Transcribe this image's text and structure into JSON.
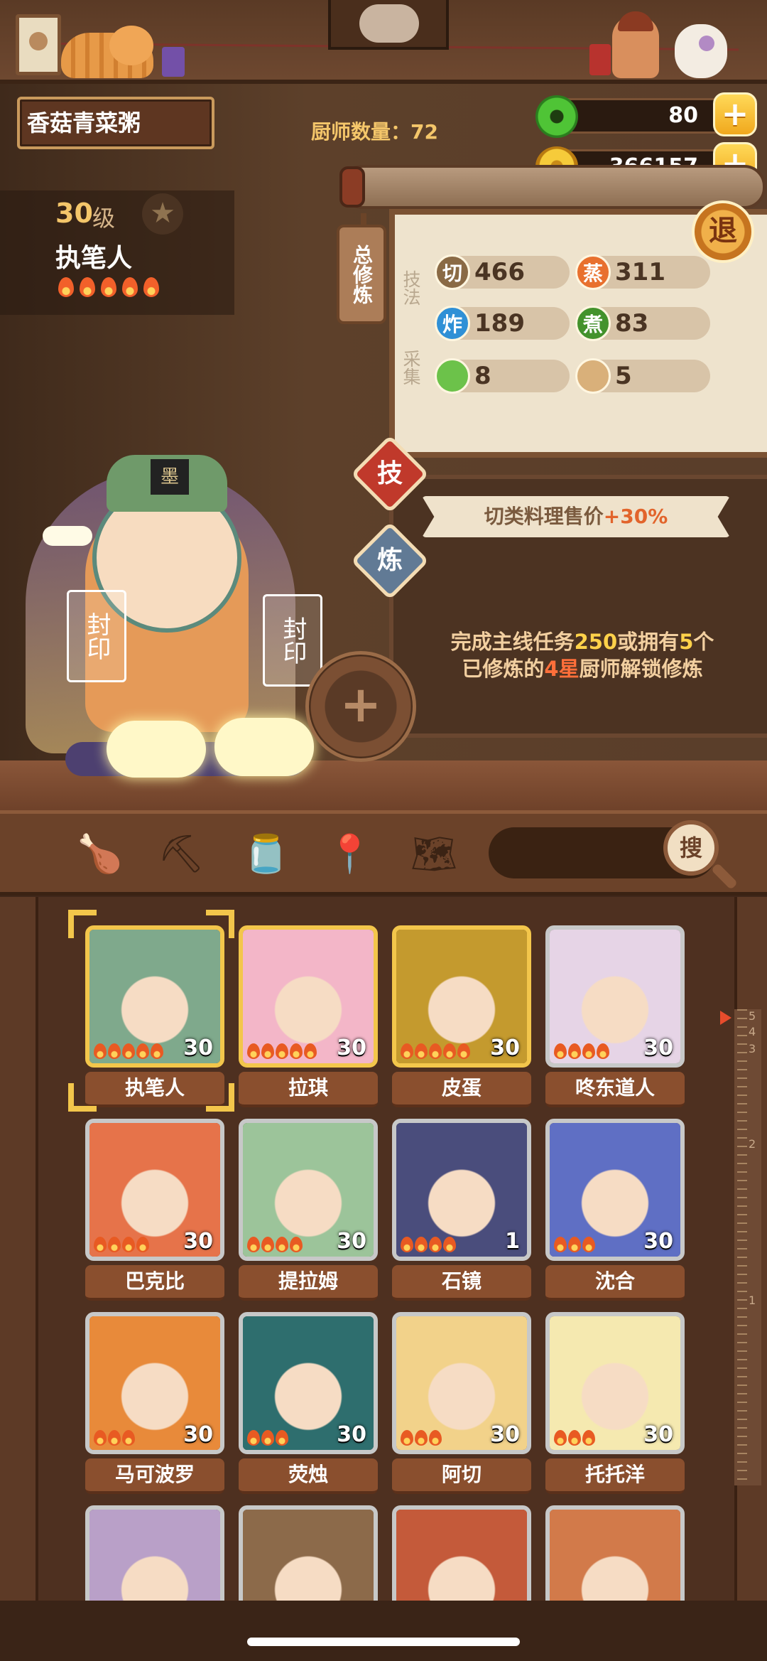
{
  "header": {
    "dish_name": "香菇青菜粥",
    "chef_count_label": "厨师数量：72"
  },
  "resources": {
    "jade": "80",
    "coins": "366157",
    "plus_symbol": "+"
  },
  "chef": {
    "level": "30",
    "level_unit": "级",
    "star_symbol": "★",
    "name": "执笔人",
    "flame_count": 5
  },
  "stats": {
    "total_tag": "总修炼",
    "skill_label": "技法",
    "gather_label": "采集",
    "skills": [
      {
        "icon": "切",
        "value": "466"
      },
      {
        "icon": "蒸",
        "value": "311"
      },
      {
        "icon": "炸",
        "value": "189"
      },
      {
        "icon": "煮",
        "value": "83"
      }
    ],
    "gather": [
      {
        "icon": "vegetable-icon",
        "value": "8"
      },
      {
        "icon": "grain-icon",
        "value": "5"
      }
    ],
    "retreat_label": "退"
  },
  "tabs": {
    "skill": "技",
    "refine": "炼"
  },
  "buff": {
    "text": "切类料理售价",
    "bonus": "+30%"
  },
  "unlock": {
    "part1": "完成主线任务",
    "quest": "250",
    "part2": "或拥有",
    "count": "5",
    "part3": "个",
    "part4": "已修炼的",
    "star": "4星",
    "part5": "厨师解锁修炼"
  },
  "showcase": {
    "hat_badge": "墨",
    "banner_left": "封印",
    "banner_right": "封印",
    "add_symbol": "+"
  },
  "toolbar": {
    "icons": [
      "drumstick-icon",
      "shovel-icon",
      "jar-icon",
      "location-pin-icon",
      "map-question-icon"
    ],
    "search_label": "搜"
  },
  "ruler": {
    "numbers": [
      "5",
      "4",
      "3",
      "2",
      "1"
    ]
  },
  "chefs": [
    {
      "name": "执笔人",
      "level": "30",
      "flames": 5,
      "rarity": "gold",
      "color": "#7fa98c"
    },
    {
      "name": "拉琪",
      "level": "30",
      "flames": 5,
      "rarity": "gold",
      "color": "#f3b6c8"
    },
    {
      "name": "皮蛋",
      "level": "30",
      "flames": 5,
      "rarity": "gold",
      "color": "#c49a2e"
    },
    {
      "name": "咚东道人",
      "level": "30",
      "flames": 4,
      "rarity": "silver",
      "color": "#e6d4e6"
    },
    {
      "name": "巴克比",
      "level": "30",
      "flames": 4,
      "rarity": "silver",
      "color": "#e6734a"
    },
    {
      "name": "提拉姆",
      "level": "30",
      "flames": 4,
      "rarity": "silver",
      "color": "#9cc49a"
    },
    {
      "name": "石镜",
      "level": "1",
      "flames": 4,
      "rarity": "silver",
      "color": "#4a4d7c"
    },
    {
      "name": "沈合",
      "level": "30",
      "flames": 3,
      "rarity": "silver",
      "color": "#5f6fc4"
    },
    {
      "name": "马可波罗",
      "level": "30",
      "flames": 3,
      "rarity": "silver",
      "color": "#e88a3a"
    },
    {
      "name": "荧烛",
      "level": "30",
      "flames": 3,
      "rarity": "silver",
      "color": "#2e6e6e"
    },
    {
      "name": "阿切",
      "level": "30",
      "flames": 3,
      "rarity": "silver",
      "color": "#f2d28a"
    },
    {
      "name": "托托洋",
      "level": "30",
      "flames": 3,
      "rarity": "silver",
      "color": "#f5e9b0"
    },
    {
      "name": "",
      "level": "",
      "flames": 0,
      "rarity": "silver",
      "color": "#b9a0c8"
    },
    {
      "name": "",
      "level": "",
      "flames": 0,
      "rarity": "silver",
      "color": "#8c6a4a"
    },
    {
      "name": "",
      "level": "",
      "flames": 0,
      "rarity": "silver",
      "color": "#c45a3a"
    },
    {
      "name": "",
      "level": "",
      "flames": 0,
      "rarity": "silver",
      "color": "#d27a4a"
    }
  ]
}
